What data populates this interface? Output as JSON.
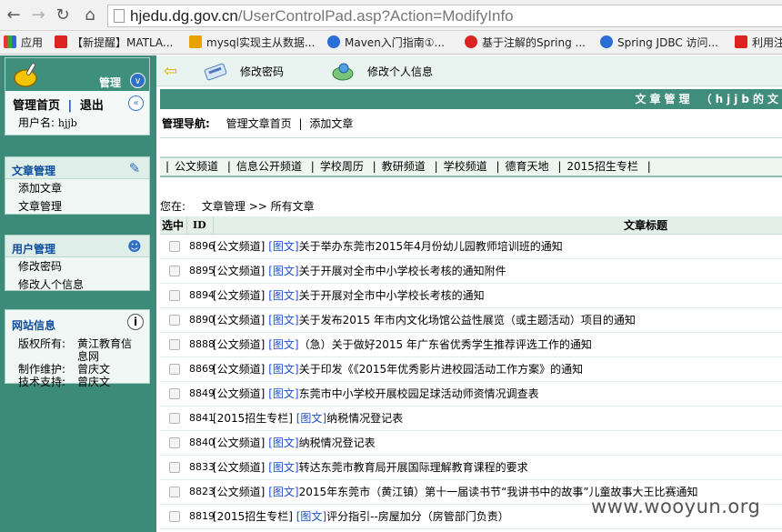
{
  "browser": {
    "url_host": "hjedu.dg.gov.cn",
    "url_path": "/UserControlPad.asp?Action=ModifyInfo",
    "bookmarks": [
      "应用",
      "【新提醒】MATLA...",
      "mysql实现主从数据...",
      "Maven入门指南①...",
      "基于注解的Spring ...",
      "Spring JDBC 访问...",
      "利用注"
    ]
  },
  "sidebar": {
    "admin_title": "管理",
    "home_link": "管理首页",
    "divider": "|",
    "logout_link": "退出",
    "username_label": "用户名:",
    "username": "hjjb",
    "article_panel": {
      "title": "文章管理",
      "items": [
        "添加文章",
        "文章管理"
      ]
    },
    "user_panel": {
      "title": "用户管理",
      "items": [
        "修改密码",
        "修改人个信息"
      ]
    },
    "site_panel": {
      "title": "网站信息",
      "copyright_label": "版权所有:",
      "copyright_value": "黄江教育信息网",
      "maintain_label": "制作维护:",
      "maintain_value": "曾庆文",
      "support_label": "技术支持:",
      "support_value": "曾庆文"
    }
  },
  "toolbar": {
    "change_password": "修改密码",
    "edit_info": "修改个人信息"
  },
  "main": {
    "title": "文章管理 （hjjb的文",
    "guide_label": "管理导航:",
    "guide_home": "管理文章首页",
    "guide_sep": "|",
    "guide_add": "添加文章",
    "channels": [
      "公文频道",
      "信息公开频道",
      "学校周历",
      "教研频道",
      "学校频道",
      "德育天地",
      "2015招生专栏"
    ],
    "breadcrumb_label": "您在:",
    "breadcrumb_section": "文章管理",
    "breadcrumb_sep": ">>",
    "breadcrumb_page": "所有文章",
    "col_select": "选中",
    "col_id": "ID",
    "col_title": "文章标题",
    "image_tag": "[图文]",
    "rows": [
      {
        "id": "8896",
        "channel": "[公文频道]",
        "title": "关于举办东莞市2015年4月份幼儿园教师培训班的通知"
      },
      {
        "id": "8895",
        "channel": "[公文频道]",
        "title": "关于开展对全市中小学校长考核的通知附件"
      },
      {
        "id": "8894",
        "channel": "[公文频道]",
        "title": "关于开展对全市中小学校长考核的通知"
      },
      {
        "id": "8890",
        "channel": "[公文频道]",
        "title": "关于发布2015 年市内文化场馆公益性展览（或主题活动）项目的通知"
      },
      {
        "id": "8888",
        "channel": "[公文频道]",
        "title": "（急）关于做好2015 年广东省优秀学生推荐评选工作的通知"
      },
      {
        "id": "8869",
        "channel": "[公文频道]",
        "title": "关于印发《《2015年优秀影片进校园活动工作方案》的通知"
      },
      {
        "id": "8849",
        "channel": "[公文频道]",
        "title": "东莞市中小学校开展校园足球活动师资情况调查表"
      },
      {
        "id": "8841",
        "channel": "[2015招生专栏]",
        "title": "纳税情况登记表"
      },
      {
        "id": "8840",
        "channel": "[公文频道]",
        "title": "纳税情况登记表"
      },
      {
        "id": "8833",
        "channel": "[公文频道]",
        "title": "转达东莞市教育局开展国际理解教育课程的要求"
      },
      {
        "id": "8823",
        "channel": "[公文频道]",
        "title": "2015年东莞市（黄江镇）第十一届读书节“我讲书中的故事”儿童故事大王比赛通知"
      },
      {
        "id": "8819",
        "channel": "[2015招生专栏]",
        "title": "评分指引--房屋加分（房管部门负责）"
      }
    ]
  },
  "watermark": "www.wooyun.org"
}
